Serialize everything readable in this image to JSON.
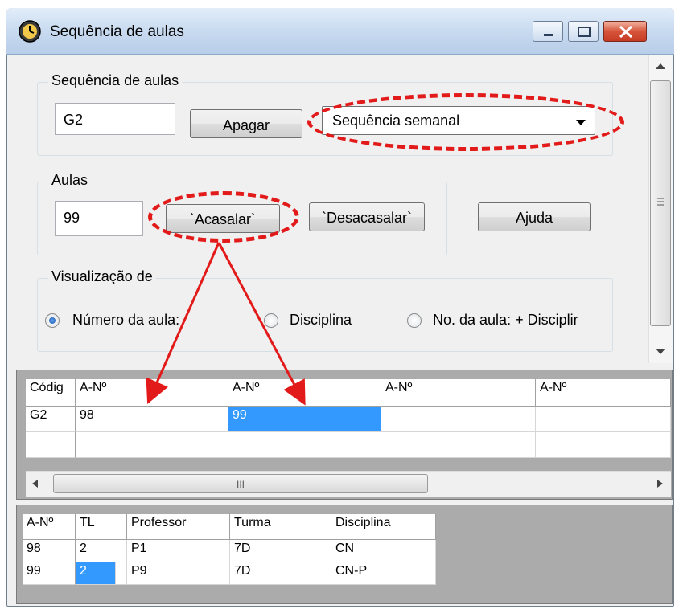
{
  "window": {
    "title": "Sequência de aulas",
    "icon": "clock-icon",
    "controls": [
      "minimize-icon",
      "maximize-icon",
      "close-icon"
    ]
  },
  "sequence_group": {
    "label": "Sequência de aulas",
    "code_value": "G2",
    "delete_label": "Apagar",
    "type_select": "Sequência semanal"
  },
  "lessons_group": {
    "label": "Aulas",
    "lesson_value": "99",
    "pair_label": "`Acasalar`",
    "unpair_label": "`Desacasalar`",
    "help_label": "Ajuda"
  },
  "view_group": {
    "label": "Visualização de",
    "options": [
      "Número da aula:",
      "Disciplina",
      "No. da aula: + Disciplir"
    ],
    "selected": "Número da aula:"
  },
  "sequence_grid": {
    "headers": [
      "Códig",
      "A-Nº",
      "A-Nº",
      "A-Nº",
      "A-Nº"
    ],
    "rows": [
      [
        "G2",
        "98",
        "99",
        "",
        ""
      ],
      [
        "",
        "",
        "",
        "",
        ""
      ]
    ],
    "selected_cell": "99"
  },
  "hscroll": {
    "grip": "III"
  },
  "lessons_table": {
    "headers": [
      "A-Nº",
      "TL",
      "Professor",
      "Turma",
      "Disciplina"
    ],
    "rows": [
      [
        "98",
        "2",
        "P1",
        "7D",
        "CN"
      ],
      [
        "99",
        "2",
        "P9",
        "7D",
        "CN-P"
      ]
    ]
  },
  "annotations": {
    "highlight_color": "#e21a1a"
  }
}
